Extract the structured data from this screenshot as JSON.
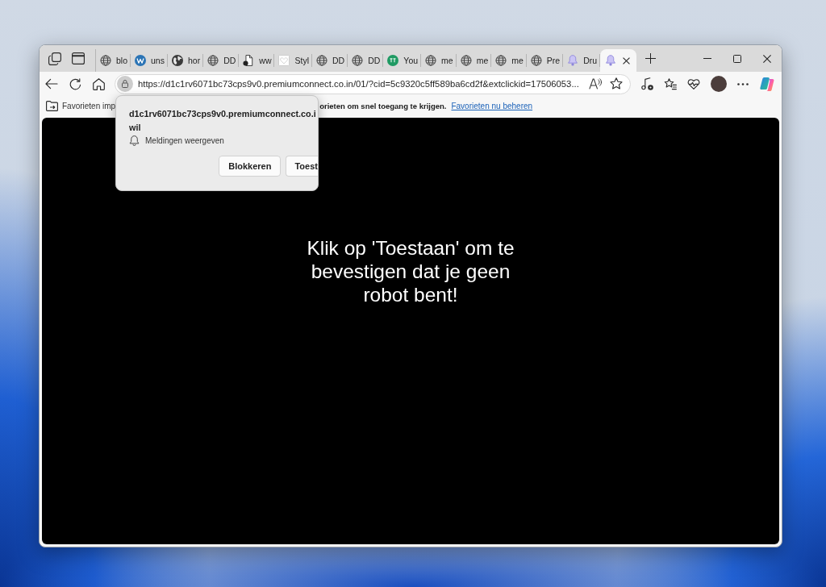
{
  "tab_strip": {
    "tabs": [
      {
        "kind": "globe",
        "label": "blo",
        "selected": false
      },
      {
        "kind": "w-logo",
        "label": "uns",
        "selected": false
      },
      {
        "kind": "earth",
        "label": "hor",
        "selected": false
      },
      {
        "kind": "globe",
        "label": "DD",
        "selected": false
      },
      {
        "kind": "document",
        "label": "ww",
        "selected": false
      },
      {
        "kind": "tile",
        "label": "Styl",
        "selected": false
      },
      {
        "kind": "globe",
        "label": "DD",
        "selected": false
      },
      {
        "kind": "globe",
        "label": "DD",
        "selected": false
      },
      {
        "kind": "green-logo",
        "label": "You",
        "selected": false
      },
      {
        "kind": "globe",
        "label": "me",
        "selected": false
      },
      {
        "kind": "globe",
        "label": "me",
        "selected": false
      },
      {
        "kind": "globe",
        "label": "me",
        "selected": false
      },
      {
        "kind": "globe",
        "label": "Pre",
        "selected": false
      },
      {
        "kind": "bell",
        "label": "Dru",
        "selected": false
      },
      {
        "kind": "bell",
        "selected": true
      }
    ]
  },
  "toolbar": {
    "url": "https://d1c1rv6071bc73cps9v0.premiumconnect.co.in/01/?cid=5c9320c5ff589ba6cd2f&extclickid=17506053..."
  },
  "favorites_bar": {
    "import_text": "Favorieten imp",
    "hint_text": "orieten om snel toegang te krijgen.",
    "link": "Favorieten nu beheren"
  },
  "permission_popup": {
    "message": "d1c1rv6071bc73cps9v0.premiumconnect.co.i wil",
    "permission": "Meldingen weergeven",
    "buttons": [
      {
        "kind": "block",
        "label": "Blokkeren"
      },
      {
        "kind": "allow",
        "label": "Toest"
      }
    ]
  },
  "page": {
    "message": "Klik op 'Toestaan' om te bevestigen dat je geen robot bent!"
  }
}
